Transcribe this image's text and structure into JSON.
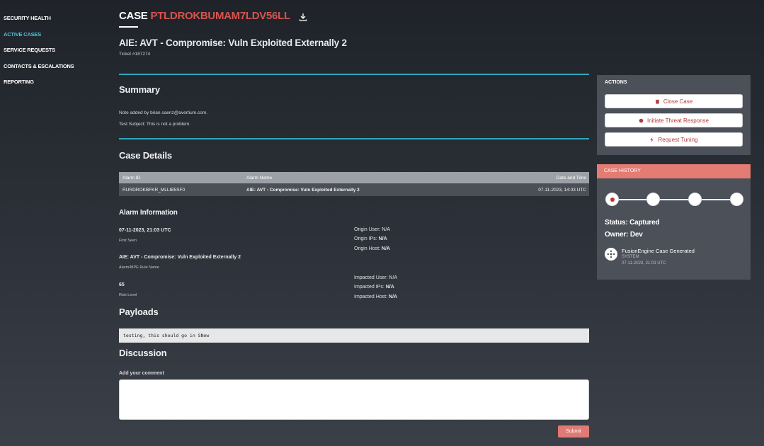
{
  "sidebar": {
    "items": [
      {
        "label": "SECURITY HEALTH"
      },
      {
        "label": "ACTIVE CASES"
      },
      {
        "label": "SERVICE REQUESTS"
      },
      {
        "label": "CONTACTS & ESCALATIONS"
      },
      {
        "label": "REPORTING"
      }
    ],
    "active_index": 1
  },
  "case": {
    "label": "CASE",
    "id": "PTLDROKBUMAM7LDV56LL",
    "title": "AIE: AVT - Compromise: Vuln Exploited Externally 2",
    "ticket": "Ticket #187274"
  },
  "summary": {
    "heading": "Summary",
    "note_line": "Note added by brian.saenz@avertium.com.",
    "subject_line": "Test Subject: This is not a problem."
  },
  "case_details": {
    "heading": "Case Details",
    "columns": [
      "Alarm ID",
      "Alarm Name",
      "Date and Time"
    ],
    "rows": [
      [
        "RURDROKBFKR_MLLIB5SF0",
        "AIE: AVT - Compromise: Vuln Exploited Externally 2",
        "07-11-2023, 14:03 UTC"
      ]
    ]
  },
  "alarm_info": {
    "heading": "Alarm Information",
    "first_seen_value": "07-11-2023, 21:03 UTC",
    "first_seen_label": "First Seen",
    "rule_value": "AIE: AVT - Compromise: Vuln Exploited Externally 2",
    "rule_label": "Alarm/MPE Rule Name",
    "risk_value": "65",
    "risk_label": "Risk Level",
    "origin_user_label": "Origin User:",
    "origin_user_value": "N/A",
    "origin_ips_label": "Origin IPs:",
    "origin_ips_value": "N/A",
    "origin_host_label": "Origin Host:",
    "origin_host_value": "N/A",
    "impacted_user_label": "Impacted User:",
    "impacted_user_value": "N/A",
    "impacted_ips_label": "Impacted IPs:",
    "impacted_ips_value": "N/A",
    "impacted_host_label": "Impacted Host:",
    "impacted_host_value": "N/A"
  },
  "payloads": {
    "heading": "Payloads",
    "text": "testing, this should go in SNow"
  },
  "discussion": {
    "heading": "Discussion",
    "comment_label": "Add your comment",
    "comment_value": "",
    "submit_label": "Submit"
  },
  "actions": {
    "title": "ACTIONS",
    "close_label": "Close Case",
    "threat_label": "Initiate Threat Response",
    "tuning_label": "Request Tuning"
  },
  "history": {
    "title": "CASE HISTORY",
    "status_label": "Status:",
    "status_value": "Captured",
    "owner_label": "Owner:",
    "owner_value": "Dev",
    "event_title": "FusionEngine Case Generated",
    "event_actor": "SYSTEM",
    "event_time": "07-11-2023, 21:03 UTC",
    "timeline_steps": 4,
    "timeline_active": 0
  },
  "colors": {
    "accent_teal": "#2fa8b9",
    "case_id_red": "#d9534f",
    "history_header": "#e57c73",
    "submit_button": "#e07a74",
    "active_nav": "#4fc3d9"
  },
  "icons": {
    "download": "download-icon",
    "close": "trash-icon",
    "threat": "dot-icon",
    "tuning": "bolt-icon",
    "event": "fusion-engine-icon"
  }
}
